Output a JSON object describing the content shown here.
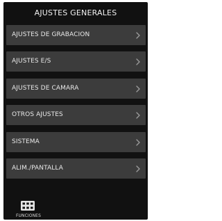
{
  "header": {
    "title": "AJUSTES GENERALES"
  },
  "menu": {
    "items": [
      {
        "label": "AJUSTES DE GRABACION",
        "icon": "chevron-right-icon"
      },
      {
        "label": "AJUSTES E/S",
        "icon": "chevron-right-icon"
      },
      {
        "label": "AJUSTES DE CAMARA",
        "icon": "chevron-right-icon"
      },
      {
        "label": "OTROS AJUSTES",
        "icon": "chevron-right-icon"
      },
      {
        "label": "SISTEMA",
        "icon": "chevron-right-icon"
      },
      {
        "label": "ALIM./PANTALLA",
        "icon": "chevron-right-icon"
      }
    ]
  },
  "footer": {
    "functions_label": "FUNCIONES",
    "functions_icon": "grid-icon"
  },
  "colors": {
    "background": "#111111",
    "item_background": "#3c3c3c",
    "text": "#e9e9e9",
    "chevron": "#9a9a9a"
  }
}
